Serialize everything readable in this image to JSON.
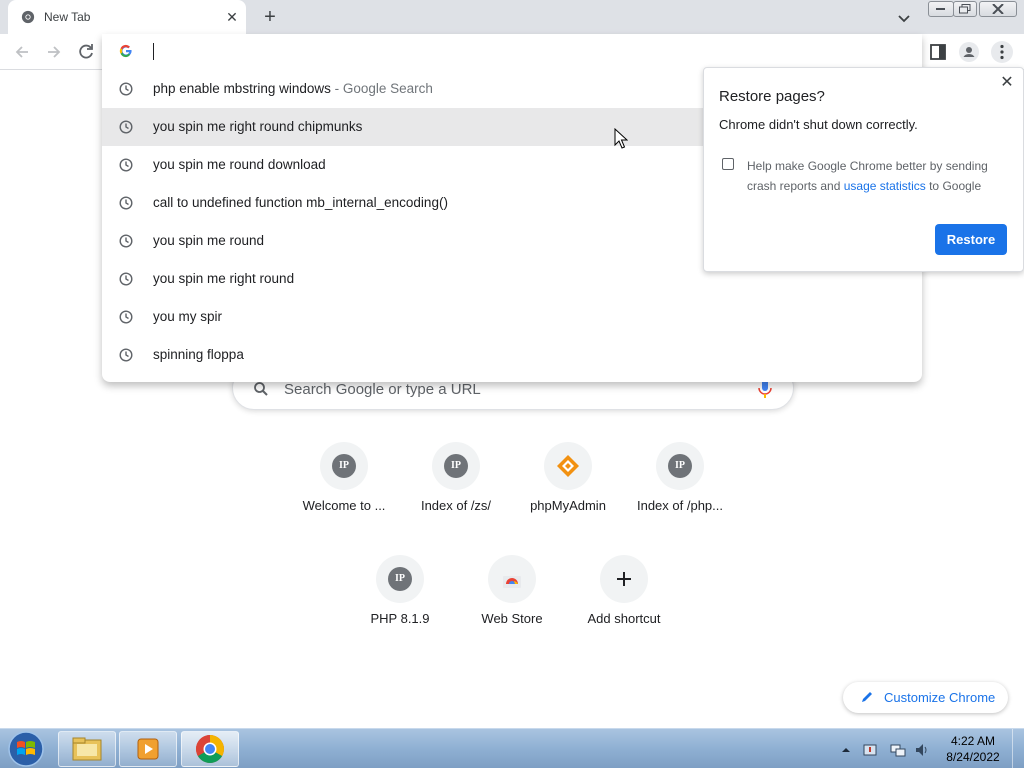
{
  "tab": {
    "title": "New Tab"
  },
  "omnibox": {
    "value": "",
    "suggestions": [
      {
        "text": "php enable mbstring windows",
        "suffix": " - Google Search",
        "icon": "history-icon"
      },
      {
        "text": "you spin me right round chipmunks",
        "suffix": "",
        "icon": "history-icon"
      },
      {
        "text": "you spin me round download",
        "suffix": "",
        "icon": "history-icon"
      },
      {
        "text": "call to undefined function mb_internal_encoding()",
        "suffix": "",
        "icon": "history-icon"
      },
      {
        "text": "you spin me round",
        "suffix": "",
        "icon": "history-icon"
      },
      {
        "text": "you spin me right round",
        "suffix": "",
        "icon": "history-icon"
      },
      {
        "text": "you my spir",
        "suffix": "",
        "icon": "history-icon"
      },
      {
        "text": "spinning floppa",
        "suffix": "",
        "icon": "history-icon"
      }
    ]
  },
  "restore_popup": {
    "title": "Restore pages?",
    "message": "Chrome didn't shut down correctly.",
    "help_prefix": "Help make Google Chrome better by sending crash reports and ",
    "help_link": "usage statistics",
    "help_suffix": " to Google",
    "button": "Restore",
    "checkbox_checked": false
  },
  "ntp": {
    "search_placeholder": "Search Google or type a URL",
    "shortcuts_row1": [
      {
        "label": "Welcome to ...",
        "icon": "IP"
      },
      {
        "label": "Index of /zs/",
        "icon": "IP"
      },
      {
        "label": "phpMyAdmin",
        "icon": "phpmyadmin-icon"
      },
      {
        "label": "Index of /php...",
        "icon": "IP"
      }
    ],
    "shortcuts_row2": [
      {
        "label": "PHP 8.1.9",
        "icon": "IP"
      },
      {
        "label": "Web Store",
        "icon": "webstore-icon"
      },
      {
        "label": "Add shortcut",
        "icon": "plus-icon"
      }
    ],
    "customize_label": "Customize Chrome"
  },
  "taskbar": {
    "time": "4:22 AM",
    "date": "8/24/2022"
  },
  "colors": {
    "accent": "#1a73e8",
    "tabstrip": "#dee1e6"
  }
}
